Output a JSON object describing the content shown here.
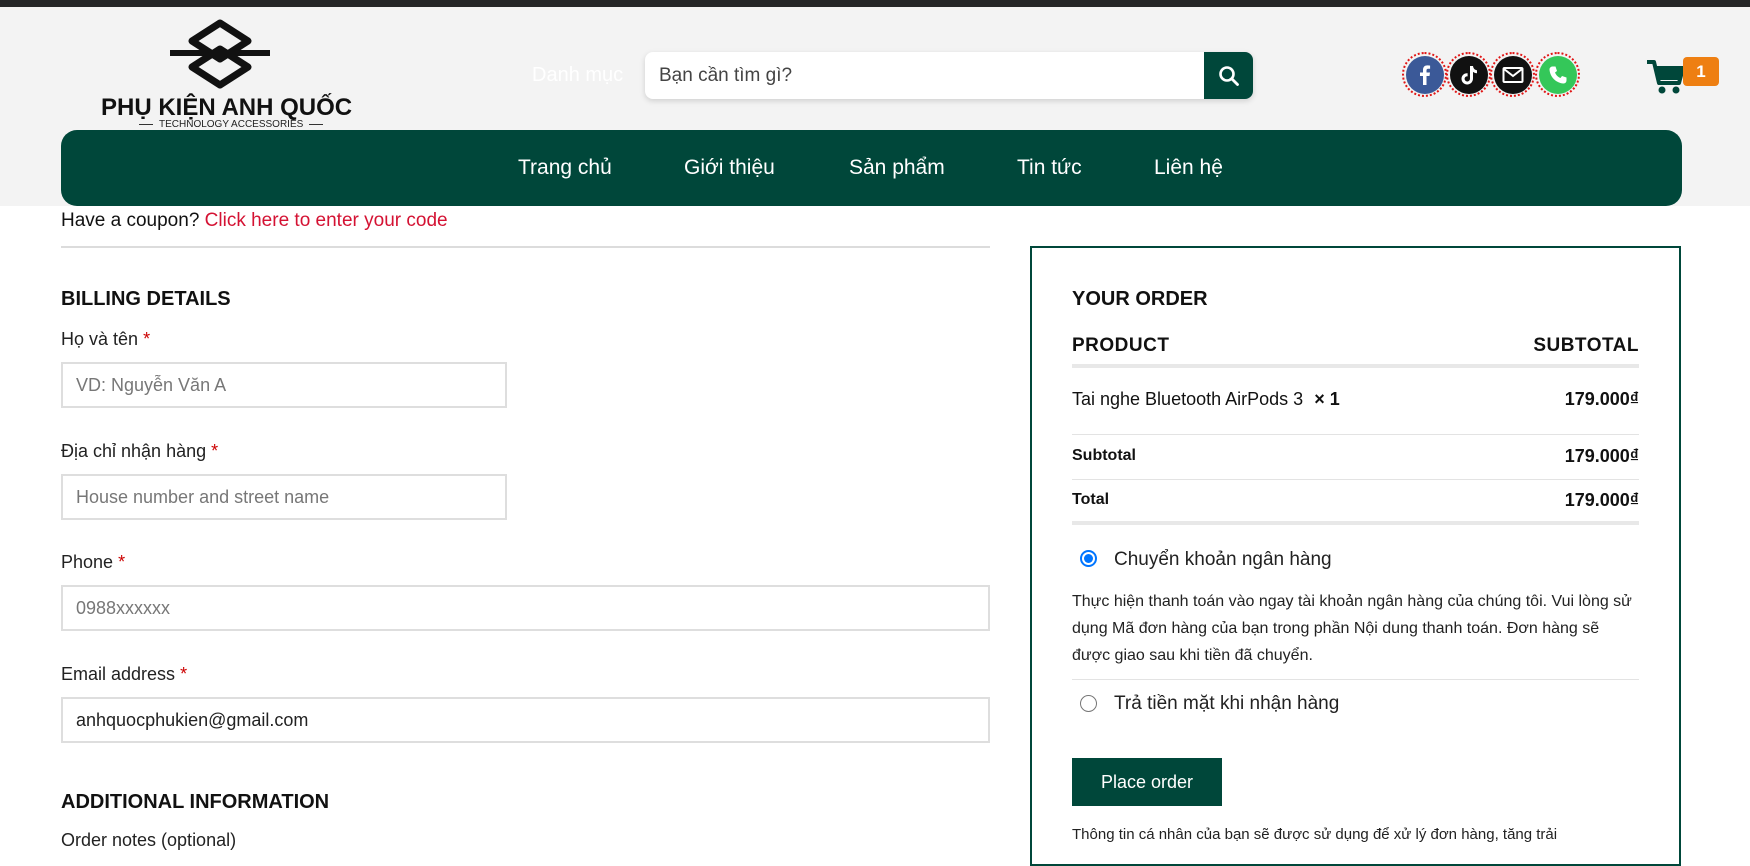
{
  "header": {
    "brand_name": "PHỤ KIỆN ANH QUỐC",
    "brand_tagline": "TECHNOLOGY ACCESSORIES",
    "category_label": "Danh mục",
    "search_placeholder": "Bạn cần tìm gì?",
    "social_icons": [
      "facebook-icon",
      "tiktok-icon",
      "email-icon",
      "phone-icon"
    ],
    "cart_count": "1",
    "accent_color": "#00473a",
    "badge_color": "#ee7f12"
  },
  "nav": {
    "items": [
      "Trang chủ",
      "Giới thiệu",
      "Sản phẩm",
      "Tin tức",
      "Liên hệ"
    ]
  },
  "coupon": {
    "text": "Have a coupon?",
    "link": "Click here to enter your code"
  },
  "billing": {
    "title": "BILLING DETAILS",
    "required_mark": "*",
    "fields": [
      {
        "label": "Họ và tên",
        "placeholder": "VD: Nguyễn Văn A",
        "value": ""
      },
      {
        "label": "Địa chỉ nhận hàng",
        "placeholder": "House number and street name",
        "value": ""
      },
      {
        "label": "Phone",
        "placeholder": "0988xxxxxx",
        "value": ""
      },
      {
        "label": "Email address",
        "placeholder": "",
        "value": "anhquocphukien@gmail.com"
      }
    ]
  },
  "additional": {
    "title": "ADDITIONAL INFORMATION",
    "notes_label": "Order notes (optional)"
  },
  "order": {
    "title": "YOUR ORDER",
    "col_product": "PRODUCT",
    "col_subtotal": "SUBTOTAL",
    "item_name": "Tai nghe Bluetooth AirPods 3",
    "item_qty": "× 1",
    "item_price": "179.000₫",
    "subtotal_label": "Subtotal",
    "subtotal_value": "179.000₫",
    "total_label": "Total",
    "total_value": "179.000₫",
    "payment_methods": [
      {
        "label": "Chuyển khoản ngân hàng",
        "selected": true
      },
      {
        "label": "Trả tiền mặt khi nhận hàng",
        "selected": false
      }
    ],
    "bank_description": "Thực hiện thanh toán vào ngay tài khoản ngân hàng của chúng tôi. Vui lòng sử dụng Mã đơn hàng của bạn trong phần Nội dung thanh toán. Đơn hàng sẽ được giao sau khi tiền đã chuyển.",
    "place_order": "Place order",
    "privacy_text": "Thông tin cá nhân của bạn sẽ được sử dụng để xử lý đơn hàng, tăng trải"
  }
}
